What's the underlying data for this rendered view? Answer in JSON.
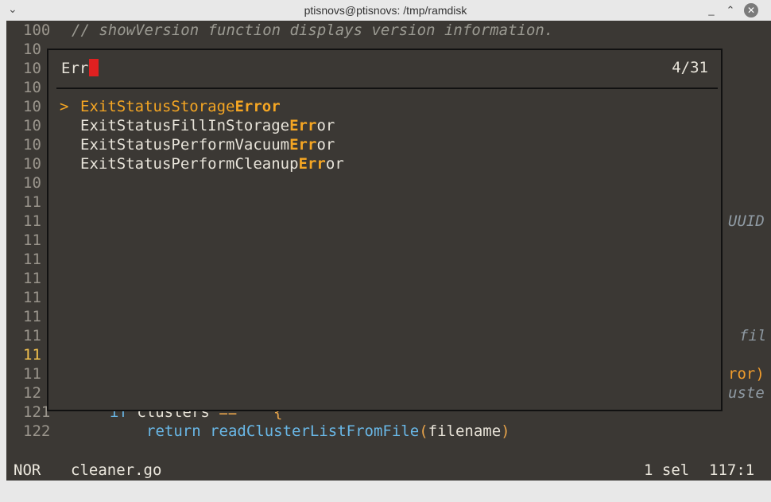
{
  "window": {
    "title": "ptisnovs@ptisnovs: /tmp/ramdisk",
    "menu_icon": "chevron-down-icon",
    "minimize_icon": "minimize-icon",
    "maximize_icon": "maximize-icon",
    "close_icon": "close-icon"
  },
  "editor": {
    "lines": [
      {
        "num": "100",
        "code": "// showVersion function displays version information.",
        "kind": "comment"
      },
      {
        "num": "10",
        "code": ""
      },
      {
        "num": "10",
        "code": ""
      },
      {
        "num": "10",
        "code": ""
      },
      {
        "num": "10",
        "code": ""
      },
      {
        "num": "10",
        "code": ""
      },
      {
        "num": "10",
        "code": ""
      },
      {
        "num": "10",
        "code": ""
      },
      {
        "num": "10",
        "code": ""
      },
      {
        "num": "11",
        "code": ""
      },
      {
        "num": "11",
        "code": ""
      },
      {
        "num": "11",
        "code": ""
      },
      {
        "num": "11",
        "code": ""
      },
      {
        "num": "11",
        "code": ""
      },
      {
        "num": "11",
        "code": ""
      },
      {
        "num": "11",
        "code": ""
      },
      {
        "num": "11",
        "code": ""
      },
      {
        "num": "11",
        "code": ""
      },
      {
        "num": "11",
        "code": ""
      },
      {
        "num": "12",
        "code": ""
      },
      {
        "num": "121",
        "code": ""
      },
      {
        "num": "122",
        "code": ""
      }
    ],
    "active_line_index": 17,
    "line121": {
      "kw": "if",
      "ident": "clusters",
      "op": "==",
      "str": "\"\"",
      "brace": "{"
    },
    "line122": {
      "kw": "return",
      "fn": "readClusterListFromFile",
      "open": "(",
      "arg": "filename",
      "close": ")"
    },
    "right_fragments": {
      "uuid": "UUID",
      "fil": "fil",
      "ror": "ror)",
      "uste": "uste"
    }
  },
  "picker": {
    "query": "Err",
    "count": "4/31",
    "marker": ">",
    "items": [
      {
        "pre": "ExitStatusStorage",
        "match": "Error",
        "post": "",
        "selected": true
      },
      {
        "pre": "ExitStatusFillInStorage",
        "match": "Err",
        "post": "or",
        "selected": false
      },
      {
        "pre": "ExitStatusPerformVacuum",
        "match": "Err",
        "post": "or",
        "selected": false
      },
      {
        "pre": "ExitStatusPerformCleanup",
        "match": "Err",
        "post": "or",
        "selected": false
      }
    ]
  },
  "status": {
    "mode": "NOR",
    "file": "cleaner.go",
    "selections": "1 sel",
    "position": "117:1"
  }
}
